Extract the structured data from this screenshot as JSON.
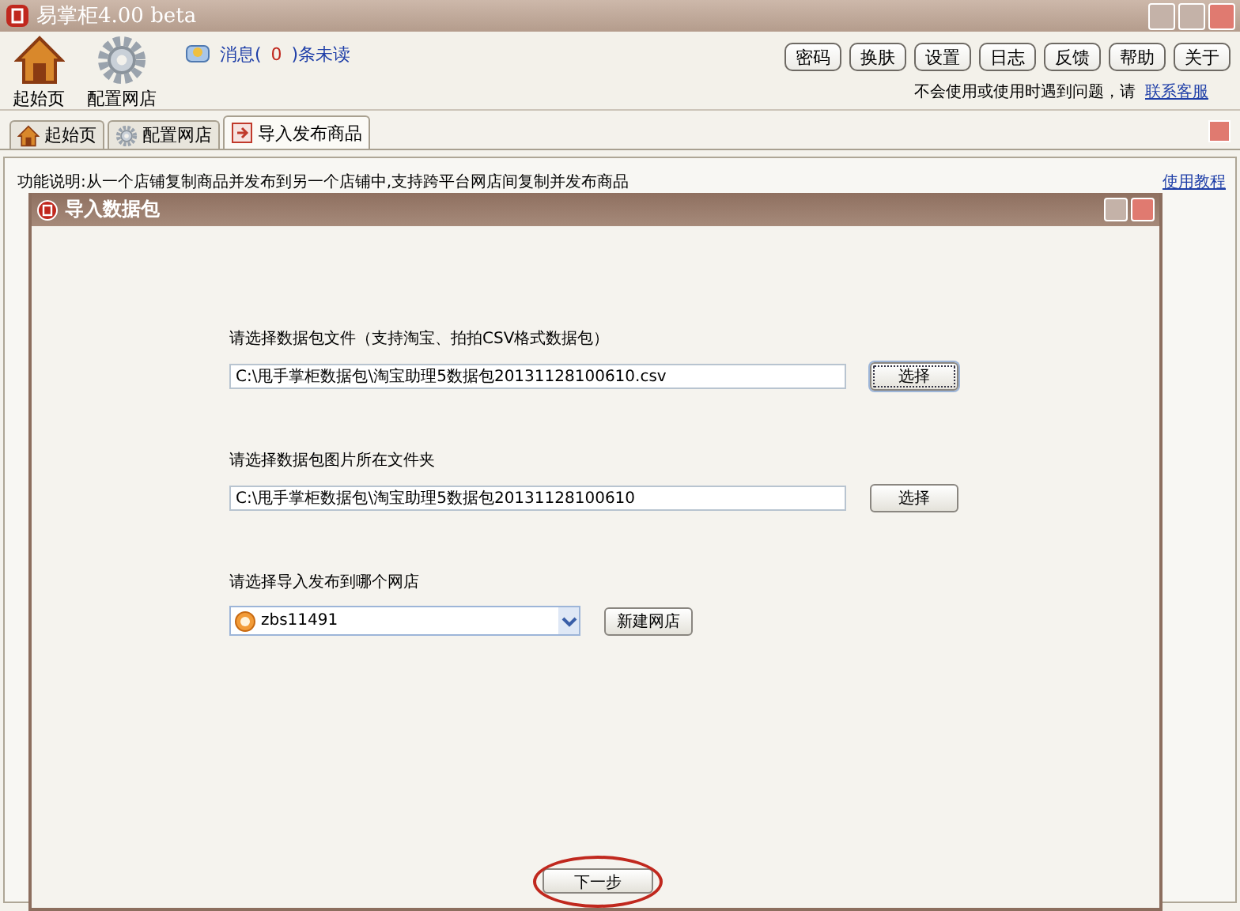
{
  "window": {
    "title": "易掌柜4.00 beta"
  },
  "toolbar": {
    "items": [
      {
        "label": "起始页",
        "kind": "home"
      },
      {
        "label": "配置网店",
        "kind": "gear"
      }
    ],
    "messages": {
      "prefix": "消息(",
      "count": "0",
      "suffix": ")条未读"
    },
    "buttons": [
      "密码",
      "换肤",
      "设置",
      "日志",
      "反馈",
      "帮助",
      "关于"
    ],
    "help": {
      "text": "不会使用或使用时遇到问题，请",
      "link": "联系客服"
    }
  },
  "tabs": [
    {
      "label": "起始页",
      "kind": "home",
      "selected": false
    },
    {
      "label": "配置网店",
      "kind": "gear",
      "selected": false
    },
    {
      "label": "导入发布商品",
      "kind": "import",
      "selected": true
    }
  ],
  "description": {
    "text": "功能说明:从一个店铺复制商品并发布到另一个店铺中,支持跨平台网店间复制并发布商品",
    "link": "使用教程"
  },
  "dialog": {
    "title": "导入数据包",
    "fields": [
      {
        "label": "请选择数据包文件（支持淘宝、拍拍CSV格式数据包）",
        "value": "C:\\甩手掌柜数据包\\淘宝助理5数据包20131128100610.csv",
        "button": "选择",
        "focused": true
      },
      {
        "label": "请选择数据包图片所在文件夹",
        "value": "C:\\甩手掌柜数据包\\淘宝助理5数据包20131128100610",
        "button": "选择",
        "focused": false
      }
    ],
    "shop": {
      "label": "请选择导入发布到哪个网店",
      "value": "zbs11491",
      "button": "新建网店"
    },
    "next": {
      "label": "下一步",
      "highlighted": true
    }
  }
}
